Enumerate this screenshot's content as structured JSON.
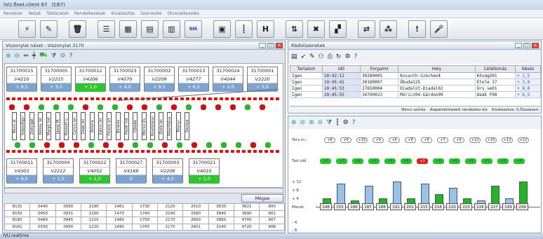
{
  "app": {
    "title": "IVU.fleet.client 67",
    "version": "(C67)"
  },
  "menu": [
    "Rendszer",
    "Nézet",
    "Táblázatok",
    "Rendelkezések",
    "Kiválasztás",
    "Szervezés",
    "Útvonalkezelés"
  ],
  "toolbar": [
    {
      "name": "signal-tool-icon",
      "glyph": "⚡"
    },
    {
      "name": "pen-tool-icon",
      "glyph": "✎"
    },
    {
      "name": "trash-icon",
      "glyph": "🗑"
    },
    {
      "name": "list-view-icon",
      "glyph": "☰"
    },
    {
      "name": "table-view-icon",
      "glyph": "▦"
    },
    {
      "name": "map-view-icon",
      "glyph": "▤"
    },
    {
      "name": "chart-view-icon",
      "glyph": "▥"
    },
    {
      "name": "gis-button",
      "glyph": "GIS"
    },
    {
      "name": "bus-monitor-icon",
      "glyph": "▣"
    },
    {
      "name": "route-line-icon",
      "glyph": "┋"
    },
    {
      "name": "headway-h-icon",
      "glyph": "H"
    },
    {
      "name": "exchange-arrows-icon",
      "glyph": "⇅"
    },
    {
      "name": "cancel-x-icon",
      "glyph": "✖"
    },
    {
      "name": "tiles-icon",
      "glyph": "▞"
    },
    {
      "name": "connect-icon",
      "glyph": "⇄"
    },
    {
      "name": "network-icon",
      "glyph": "⁂"
    },
    {
      "name": "alert-bubble-icon",
      "glyph": "!"
    },
    {
      "name": "microphone-icon",
      "glyph": "🎤"
    }
  ],
  "left_panel": {
    "title": "Viszonylat nézet - Viszonylat 3170",
    "more_label": "Mégse",
    "top_stops": [
      {
        "id": "31700015",
        "line": "V4210",
        "delay": "+ 8,5"
      },
      {
        "id": "31700005",
        "line": "V2215",
        "delay": "+ 3,0"
      },
      {
        "id": "31700012",
        "line": "V4206",
        "delay": "+ 1,0"
      },
      {
        "id": "31700023",
        "line": "V4070",
        "delay": "+ 4,0"
      },
      {
        "id": "31700002",
        "line": "V2209",
        "delay": "+ 9,5"
      },
      {
        "id": "31700013",
        "line": "V4277",
        "delay": "+ 6,5"
      },
      {
        "id": "31700024",
        "line": "V4044",
        "delay": "+ 2,0"
      },
      {
        "id": "31700001",
        "line": "V2220",
        "delay": "+ 3,0"
      }
    ],
    "bottom_stops": [
      {
        "id": "31700011",
        "line": "V4303",
        "delay": "+ 6,5"
      },
      {
        "id": "31700004",
        "line": "V2212",
        "delay": "+ 1,5"
      },
      {
        "id": "31700022",
        "line": "V4052",
        "delay": "+ 1,0"
      },
      {
        "id": "31700027",
        "line": "V4169",
        "delay": "0"
      },
      {
        "id": "31700003",
        "line": "V2206",
        "delay": "+ 4,0"
      },
      {
        "id": "31700021",
        "line": "V4010",
        "delay": "+ 1,0"
      }
    ],
    "stop_names": [
      "Bécsi út",
      "Szépvölgyi",
      "Zsélyigát",
      "Kolosy tér",
      "Margit híd",
      "Jászai M.",
      "Kossuth L.",
      "Corvin tér",
      "Deák tér",
      "Astoria",
      "Kálvin tér",
      "Ferenc krt",
      "Boráros",
      "Petőfi híd",
      "Újbuda",
      "Móricz Zs.",
      "Kosztolányi",
      "Etele tér",
      "Albertfalva",
      "Tétényi",
      "Savoya"
    ],
    "grid": [
      [
        "8131",
        "0440",
        "0930",
        "1190",
        "1461",
        "1730",
        "2120",
        "2510",
        "3630",
        "3621",
        "900"
      ],
      [
        "8150",
        "0450",
        "0931",
        "1200",
        "1470",
        "1740",
        "2140",
        "2580",
        "3840",
        "3690",
        "901"
      ],
      [
        "8160",
        "0460",
        "0945",
        "1210",
        "1480",
        "1750",
        "2170",
        "2600",
        "3860",
        "4700",
        "907"
      ],
      [
        "8161",
        "0530",
        "0950",
        "1220",
        "1490",
        "1765",
        "2175",
        "2601",
        "3140",
        "4720",
        "908"
      ]
    ]
  },
  "radio_panel": {
    "title": "Rádióüzenetek",
    "columns": [
      "Tartalom",
      "Idő",
      "Forgalmi",
      "Hely",
      "Célállomás",
      "Késés"
    ],
    "rows": [
      [
        "Igen",
        "10:42:12",
        "30280005",
        "Kossuth-Széchen4",
        "Kővágó01",
        "+ 1,5"
      ],
      [
        "Igen",
        "10:45:41",
        "30180007",
        "Óbuda125",
        "Etele 17",
        "+ 3,0"
      ],
      [
        "Igen",
        "10:45:53",
        "27650004",
        "Diadalút-Diadal02",
        "Örs ve01",
        "+ 8,0"
      ],
      [
        "Igen",
        "10:45:55",
        "34700023",
        "Móricz04-Gárdon09",
        "Deák F08",
        "+ 6,5"
      ]
    ],
    "status": [
      "Nincs szűrés",
      "Alapértelmezett rendezési elv",
      "Kiválasztva: 0,Összesen:"
    ]
  },
  "headway_panel": {
    "labels": [
      "Terv.m.:",
      "Tart.idő",
      "+ 12",
      "+ 8",
      "+ 4",
      "Menet",
      "- 4",
      "- 8"
    ],
    "terv": [
      "+8",
      "+9",
      "+10",
      "+9",
      "+6",
      "+8",
      "+6",
      "+7",
      "+9",
      "+12",
      "+10",
      "+12",
      "+12"
    ],
    "tart": [
      "+7",
      "+7",
      "+6",
      "+5",
      "+8",
      "+6",
      "+2",
      "+8",
      "+6",
      "+9",
      "+5",
      "+5",
      "+6"
    ],
    "menet": [
      "148",
      "155",
      "186",
      "187",
      "188",
      "191",
      "201",
      "215",
      "218",
      "220",
      "223",
      "226",
      "227",
      "249",
      "299"
    ]
  },
  "taskbar": {
    "title": "IVU.realtime"
  }
}
